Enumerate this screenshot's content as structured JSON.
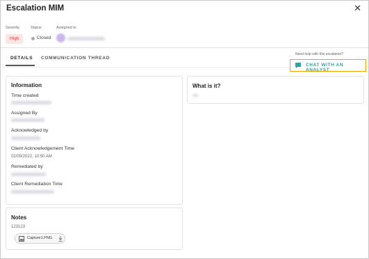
{
  "dialog": {
    "title": "Escalation MIM",
    "close_glyph": "✕"
  },
  "meta": {
    "severity_label": "Severity",
    "severity_value": "High",
    "status_label": "Status",
    "status_value": "Closed",
    "assigned_label": "Assigned to"
  },
  "tabs": [
    {
      "label": "DETAILS",
      "active": true
    },
    {
      "label": "COMMUNICATION THREAD",
      "active": false
    }
  ],
  "help": {
    "prompt": "Need help with this escalation?",
    "chat_label": "CHAT WITH AN ANALYST"
  },
  "information": {
    "title": "Information",
    "fields": [
      {
        "label": "Time created",
        "value": ""
      },
      {
        "label": "Assigned By",
        "value": ""
      },
      {
        "label": "Acknowledged by",
        "value": ""
      },
      {
        "label": "Client Acknowledgement Time",
        "value": "02/09/2022, 10:50 AM"
      },
      {
        "label": "Remediated by",
        "value": ""
      },
      {
        "label": "Client Remediation Time",
        "value": ""
      }
    ]
  },
  "notes": {
    "title": "Notes",
    "text": "123123",
    "attachment": {
      "name": "Capture1.PNG"
    }
  },
  "what_is_it": {
    "title": "What is it?"
  },
  "colors": {
    "accent_teal": "#2aa6a0",
    "highlight_orange": "#f0a500",
    "severity_red": "#d33"
  }
}
